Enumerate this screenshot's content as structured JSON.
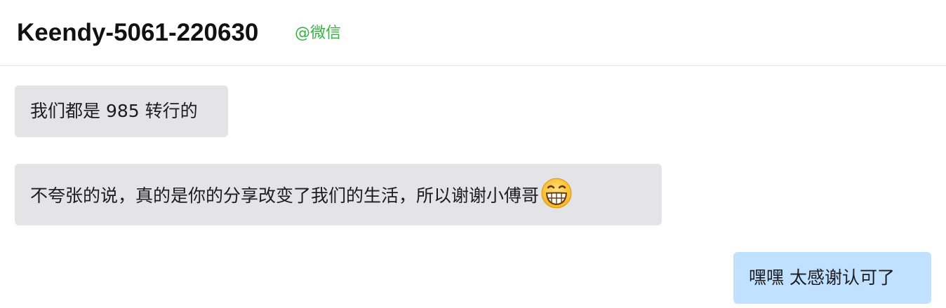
{
  "header": {
    "title": "Keendy-5061-220630",
    "platform": "@微信"
  },
  "messages": [
    {
      "direction": "incoming",
      "text": "我们都是 985 转行的"
    },
    {
      "direction": "incoming",
      "text": "不夸张的说，真的是你的分享改变了我们的生活，所以谢谢小傅哥",
      "emoji": "grinning-face-icon"
    },
    {
      "direction": "outgoing",
      "text": "嘿嘿 太感谢认可了"
    }
  ],
  "colors": {
    "platform": "#35b340",
    "incoming_bubble": "#e4e4e6",
    "outgoing_bubble": "#c0e1ff",
    "divider": "#e3e3e6"
  }
}
